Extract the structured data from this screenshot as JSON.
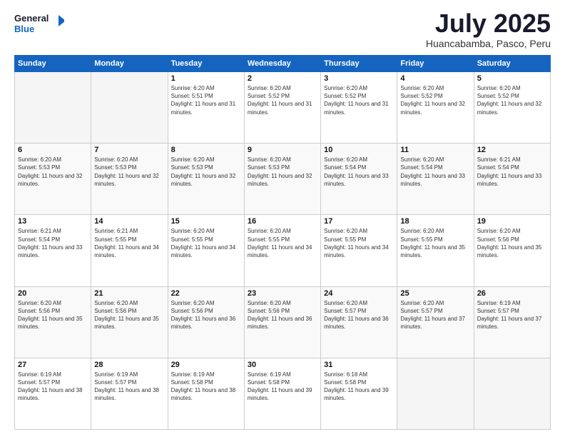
{
  "header": {
    "logo_general": "General",
    "logo_blue": "Blue",
    "month_title": "July 2025",
    "location": "Huancabamba, Pasco, Peru"
  },
  "days_of_week": [
    "Sunday",
    "Monday",
    "Tuesday",
    "Wednesday",
    "Thursday",
    "Friday",
    "Saturday"
  ],
  "weeks": [
    [
      {
        "day": "",
        "sunrise": "",
        "sunset": "",
        "daylight": ""
      },
      {
        "day": "",
        "sunrise": "",
        "sunset": "",
        "daylight": ""
      },
      {
        "day": "1",
        "sunrise": "Sunrise: 6:20 AM",
        "sunset": "Sunset: 5:51 PM",
        "daylight": "Daylight: 11 hours and 31 minutes."
      },
      {
        "day": "2",
        "sunrise": "Sunrise: 6:20 AM",
        "sunset": "Sunset: 5:52 PM",
        "daylight": "Daylight: 11 hours and 31 minutes."
      },
      {
        "day": "3",
        "sunrise": "Sunrise: 6:20 AM",
        "sunset": "Sunset: 5:52 PM",
        "daylight": "Daylight: 11 hours and 31 minutes."
      },
      {
        "day": "4",
        "sunrise": "Sunrise: 6:20 AM",
        "sunset": "Sunset: 5:52 PM",
        "daylight": "Daylight: 11 hours and 32 minutes."
      },
      {
        "day": "5",
        "sunrise": "Sunrise: 6:20 AM",
        "sunset": "Sunset: 5:52 PM",
        "daylight": "Daylight: 11 hours and 32 minutes."
      }
    ],
    [
      {
        "day": "6",
        "sunrise": "Sunrise: 6:20 AM",
        "sunset": "Sunset: 5:53 PM",
        "daylight": "Daylight: 11 hours and 32 minutes."
      },
      {
        "day": "7",
        "sunrise": "Sunrise: 6:20 AM",
        "sunset": "Sunset: 5:53 PM",
        "daylight": "Daylight: 11 hours and 32 minutes."
      },
      {
        "day": "8",
        "sunrise": "Sunrise: 6:20 AM",
        "sunset": "Sunset: 5:53 PM",
        "daylight": "Daylight: 11 hours and 32 minutes."
      },
      {
        "day": "9",
        "sunrise": "Sunrise: 6:20 AM",
        "sunset": "Sunset: 5:53 PM",
        "daylight": "Daylight: 11 hours and 32 minutes."
      },
      {
        "day": "10",
        "sunrise": "Sunrise: 6:20 AM",
        "sunset": "Sunset: 5:54 PM",
        "daylight": "Daylight: 11 hours and 33 minutes."
      },
      {
        "day": "11",
        "sunrise": "Sunrise: 6:20 AM",
        "sunset": "Sunset: 5:54 PM",
        "daylight": "Daylight: 11 hours and 33 minutes."
      },
      {
        "day": "12",
        "sunrise": "Sunrise: 6:21 AM",
        "sunset": "Sunset: 5:54 PM",
        "daylight": "Daylight: 11 hours and 33 minutes."
      }
    ],
    [
      {
        "day": "13",
        "sunrise": "Sunrise: 6:21 AM",
        "sunset": "Sunset: 5:54 PM",
        "daylight": "Daylight: 11 hours and 33 minutes."
      },
      {
        "day": "14",
        "sunrise": "Sunrise: 6:21 AM",
        "sunset": "Sunset: 5:55 PM",
        "daylight": "Daylight: 11 hours and 34 minutes."
      },
      {
        "day": "15",
        "sunrise": "Sunrise: 6:20 AM",
        "sunset": "Sunset: 5:55 PM",
        "daylight": "Daylight: 11 hours and 34 minutes."
      },
      {
        "day": "16",
        "sunrise": "Sunrise: 6:20 AM",
        "sunset": "Sunset: 5:55 PM",
        "daylight": "Daylight: 11 hours and 34 minutes."
      },
      {
        "day": "17",
        "sunrise": "Sunrise: 6:20 AM",
        "sunset": "Sunset: 5:55 PM",
        "daylight": "Daylight: 11 hours and 34 minutes."
      },
      {
        "day": "18",
        "sunrise": "Sunrise: 6:20 AM",
        "sunset": "Sunset: 5:55 PM",
        "daylight": "Daylight: 11 hours and 35 minutes."
      },
      {
        "day": "19",
        "sunrise": "Sunrise: 6:20 AM",
        "sunset": "Sunset: 5:56 PM",
        "daylight": "Daylight: 11 hours and 35 minutes."
      }
    ],
    [
      {
        "day": "20",
        "sunrise": "Sunrise: 6:20 AM",
        "sunset": "Sunset: 5:56 PM",
        "daylight": "Daylight: 11 hours and 35 minutes."
      },
      {
        "day": "21",
        "sunrise": "Sunrise: 6:20 AM",
        "sunset": "Sunset: 5:56 PM",
        "daylight": "Daylight: 11 hours and 35 minutes."
      },
      {
        "day": "22",
        "sunrise": "Sunrise: 6:20 AM",
        "sunset": "Sunset: 5:56 PM",
        "daylight": "Daylight: 11 hours and 36 minutes."
      },
      {
        "day": "23",
        "sunrise": "Sunrise: 6:20 AM",
        "sunset": "Sunset: 5:56 PM",
        "daylight": "Daylight: 11 hours and 36 minutes."
      },
      {
        "day": "24",
        "sunrise": "Sunrise: 6:20 AM",
        "sunset": "Sunset: 5:57 PM",
        "daylight": "Daylight: 11 hours and 36 minutes."
      },
      {
        "day": "25",
        "sunrise": "Sunrise: 6:20 AM",
        "sunset": "Sunset: 5:57 PM",
        "daylight": "Daylight: 11 hours and 37 minutes."
      },
      {
        "day": "26",
        "sunrise": "Sunrise: 6:19 AM",
        "sunset": "Sunset: 5:57 PM",
        "daylight": "Daylight: 11 hours and 37 minutes."
      }
    ],
    [
      {
        "day": "27",
        "sunrise": "Sunrise: 6:19 AM",
        "sunset": "Sunset: 5:57 PM",
        "daylight": "Daylight: 11 hours and 38 minutes."
      },
      {
        "day": "28",
        "sunrise": "Sunrise: 6:19 AM",
        "sunset": "Sunset: 5:57 PM",
        "daylight": "Daylight: 11 hours and 38 minutes."
      },
      {
        "day": "29",
        "sunrise": "Sunrise: 6:19 AM",
        "sunset": "Sunset: 5:58 PM",
        "daylight": "Daylight: 11 hours and 38 minutes."
      },
      {
        "day": "30",
        "sunrise": "Sunrise: 6:19 AM",
        "sunset": "Sunset: 5:58 PM",
        "daylight": "Daylight: 11 hours and 39 minutes."
      },
      {
        "day": "31",
        "sunrise": "Sunrise: 6:18 AM",
        "sunset": "Sunset: 5:58 PM",
        "daylight": "Daylight: 11 hours and 39 minutes."
      },
      {
        "day": "",
        "sunrise": "",
        "sunset": "",
        "daylight": ""
      },
      {
        "day": "",
        "sunrise": "",
        "sunset": "",
        "daylight": ""
      }
    ]
  ]
}
